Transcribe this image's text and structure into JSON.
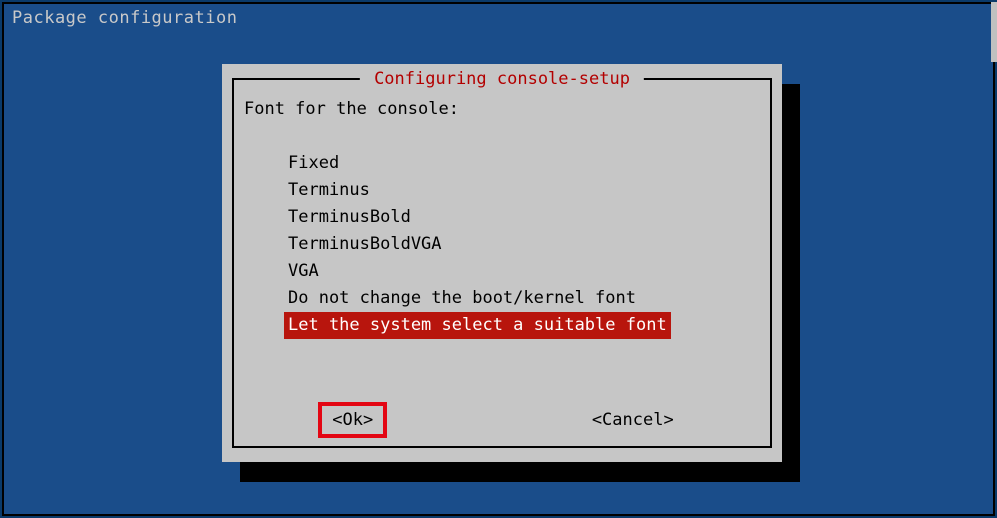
{
  "header": {
    "title": "Package configuration"
  },
  "dialog": {
    "title": " Configuring console-setup ",
    "prompt": "Font for the console:",
    "options": [
      "Fixed",
      "Terminus",
      "TerminusBold",
      "TerminusBoldVGA",
      "VGA",
      "Do not change the boot/kernel font",
      "Let the system select a suitable font"
    ],
    "selected_index": 6,
    "buttons": {
      "ok": "<Ok>",
      "cancel": "<Cancel>"
    },
    "focused_button": "ok"
  },
  "colors": {
    "background": "#1a4d8a",
    "dialog_bg": "#c6c6c6",
    "title_fg": "#b30000",
    "selection_bg": "#b8150d",
    "focus_border": "#e30613"
  }
}
